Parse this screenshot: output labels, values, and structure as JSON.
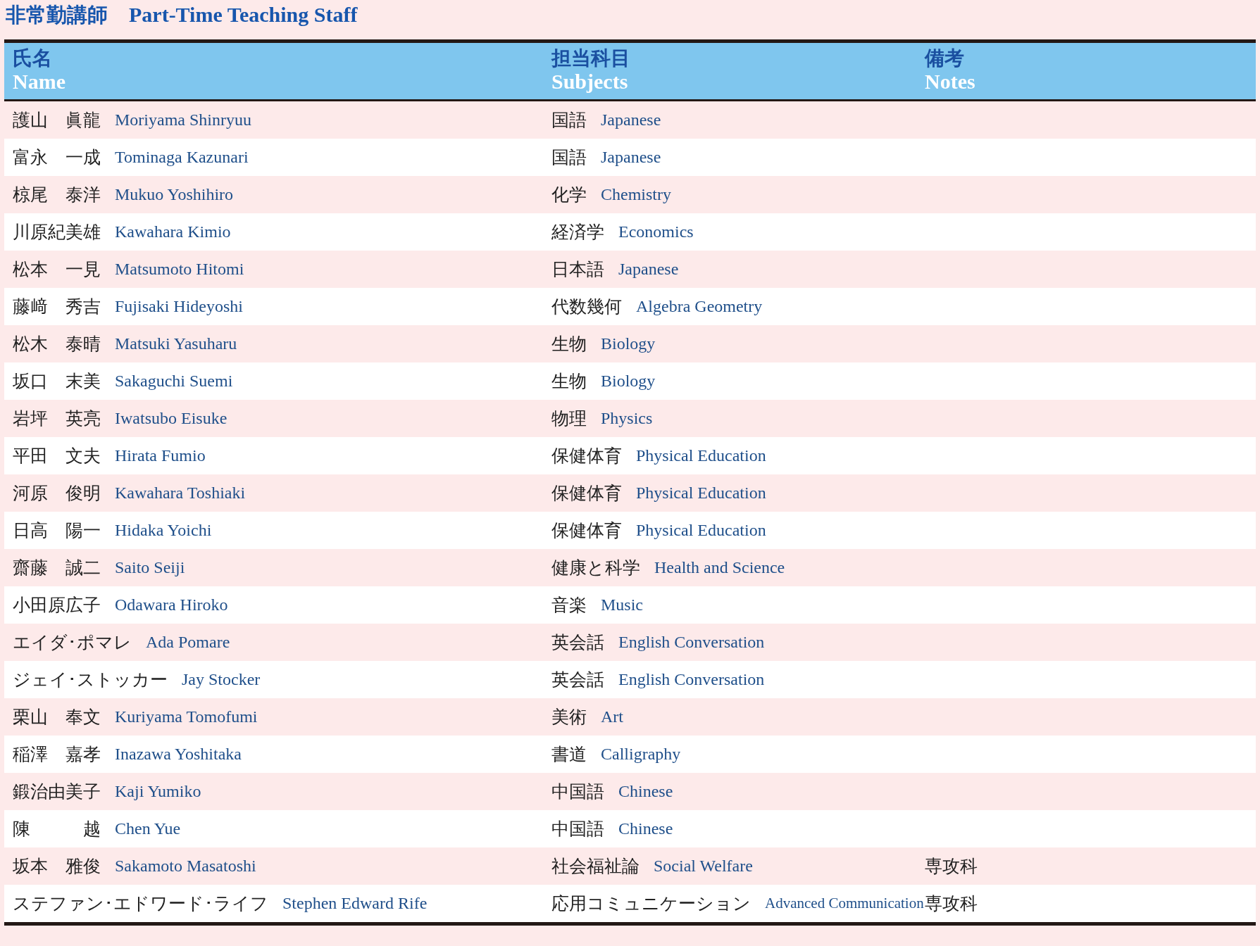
{
  "title": {
    "ja": "非常勤講師",
    "en": "Part-Time Teaching Staff"
  },
  "columns": [
    {
      "ja": "氏名",
      "en": "Name"
    },
    {
      "ja": "担当科目",
      "en": "Subjects"
    },
    {
      "ja": "備考",
      "en": "Notes"
    }
  ],
  "rows": [
    {
      "name_ja": "護山　眞龍",
      "name_en": "Moriyama Shinryuu",
      "subject_ja": "国語",
      "subject_en": "Japanese"
    },
    {
      "name_ja": "富永　一成",
      "name_en": "Tominaga Kazunari",
      "subject_ja": "国語",
      "subject_en": "Japanese"
    },
    {
      "name_ja": "椋尾　泰洋",
      "name_en": "Mukuo Yoshihiro",
      "subject_ja": "化学",
      "subject_en": "Chemistry"
    },
    {
      "name_ja": "川原紀美雄",
      "name_en": "Kawahara Kimio",
      "subject_ja": "経済学",
      "subject_en": "Economics"
    },
    {
      "name_ja": "松本　一見",
      "name_en": "Matsumoto Hitomi",
      "subject_ja": "日本語",
      "subject_en": "Japanese"
    },
    {
      "name_ja": "藤﨑　秀吉",
      "name_en": "Fujisaki Hideyoshi",
      "subject_ja": "代数幾何",
      "subject_en": "Algebra Geometry"
    },
    {
      "name_ja": "松木　泰晴",
      "name_en": "Matsuki Yasuharu",
      "subject_ja": "生物",
      "subject_en": "Biology"
    },
    {
      "name_ja": "坂口　末美",
      "name_en": "Sakaguchi Suemi",
      "subject_ja": "生物",
      "subject_en": "Biology"
    },
    {
      "name_ja": "岩坪　英亮",
      "name_en": "Iwatsubo Eisuke",
      "subject_ja": "物理",
      "subject_en": "Physics"
    },
    {
      "name_ja": "平田　文夫",
      "name_en": "Hirata Fumio",
      "subject_ja": "保健体育",
      "subject_en": "Physical Education"
    },
    {
      "name_ja": "河原　俊明",
      "name_en": "Kawahara Toshiaki",
      "subject_ja": "保健体育",
      "subject_en": "Physical Education"
    },
    {
      "name_ja": "日高　陽一",
      "name_en": "Hidaka Yoichi",
      "subject_ja": "保健体育",
      "subject_en": "Physical Education"
    },
    {
      "name_ja": "齋藤　誠二",
      "name_en": "Saito Seiji",
      "subject_ja": "健康と科学",
      "subject_en": "Health and Science"
    },
    {
      "name_ja": "小田原広子",
      "name_en": "Odawara Hiroko",
      "subject_ja": "音楽",
      "subject_en": "Music"
    },
    {
      "name_ja": "エイダ･ポマレ",
      "name_en": "Ada Pomare",
      "subject_ja": "英会話",
      "subject_en": "English Conversation"
    },
    {
      "name_ja": "ジェイ･ストッカー",
      "name_en": "Jay Stocker",
      "subject_ja": "英会話",
      "subject_en": "English Conversation"
    },
    {
      "name_ja": "栗山　奉文",
      "name_en": "Kuriyama Tomofumi",
      "subject_ja": "美術",
      "subject_en": "Art"
    },
    {
      "name_ja": "稲澤　嘉孝",
      "name_en": "Inazawa Yoshitaka",
      "subject_ja": "書道",
      "subject_en": "Calligraphy"
    },
    {
      "name_ja": "鍛治由美子",
      "name_en": "Kaji Yumiko",
      "subject_ja": "中国語",
      "subject_en": "Chinese"
    },
    {
      "name_ja": "陳　　　越",
      "name_en": "Chen Yue",
      "subject_ja": "中国語",
      "subject_en": "Chinese"
    },
    {
      "name_ja": "坂本　雅俊",
      "name_en": "Sakamoto Masatoshi",
      "subject_ja": "社会福祉論",
      "subject_en": "Social Welfare",
      "notes": "専攻科"
    },
    {
      "name_ja": "ステファン･エドワード･ライフ",
      "name_en": "Stephen Edward Rife",
      "subject_ja": "応用コミュニケーション",
      "subject_en": "Advanced Communication",
      "notes": "専攻科"
    }
  ]
}
